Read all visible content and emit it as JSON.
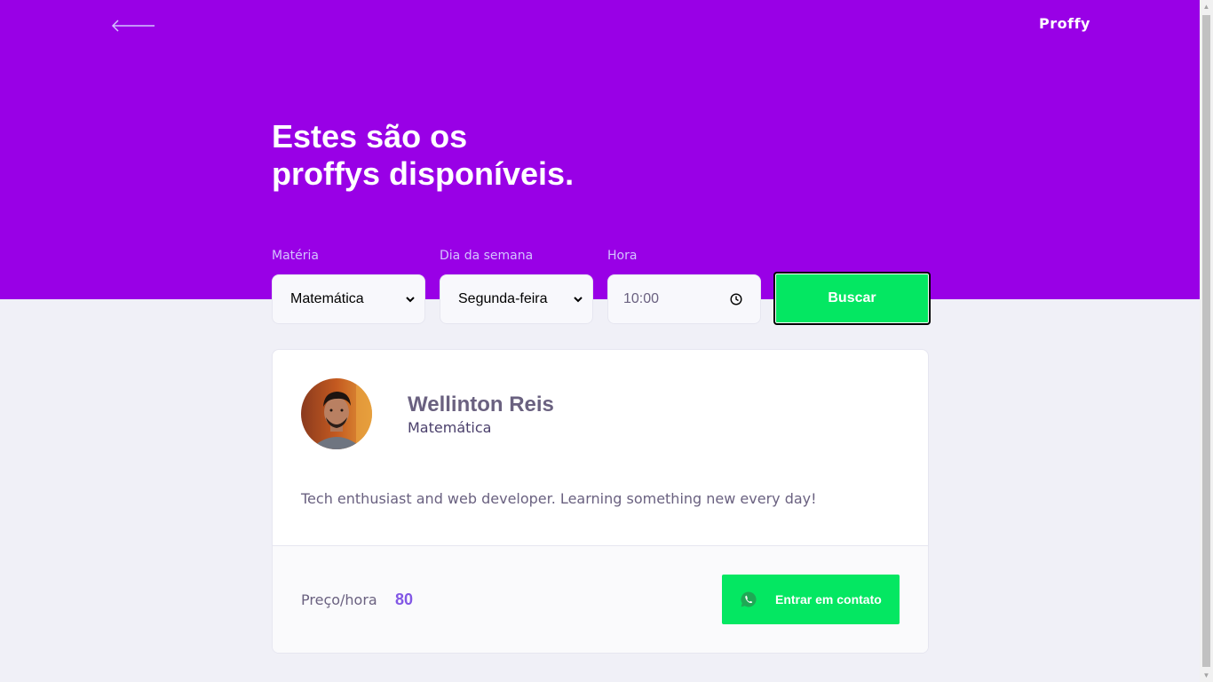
{
  "header": {
    "logo": "Proffy",
    "title_line1": "Estes são os",
    "title_line2": "proffys disponíveis."
  },
  "filters": {
    "subject_label": "Matéria",
    "subject_value": "Matemática",
    "weekday_label": "Dia da semana",
    "weekday_value": "Segunda-feira",
    "time_label": "Hora",
    "time_value": "10:00",
    "search_label": "Buscar"
  },
  "teacher": {
    "name": "Wellinton Reis",
    "subject": "Matemática",
    "bio": "Tech enthusiast and web developer. Learning something new every day!",
    "price_label": "Preço/hora",
    "price_value": "80",
    "contact_label": "Entrar em contato"
  },
  "colors": {
    "primary": "#9900E6",
    "secondary": "#04E762",
    "background": "#F0F0F7",
    "text": "#6A6180"
  },
  "icons": {
    "back": "arrow-left-icon",
    "time": "clock-icon",
    "contact": "whatsapp-icon",
    "subject_dropdown": "chevron-down-icon",
    "weekday_dropdown": "chevron-down-icon"
  }
}
